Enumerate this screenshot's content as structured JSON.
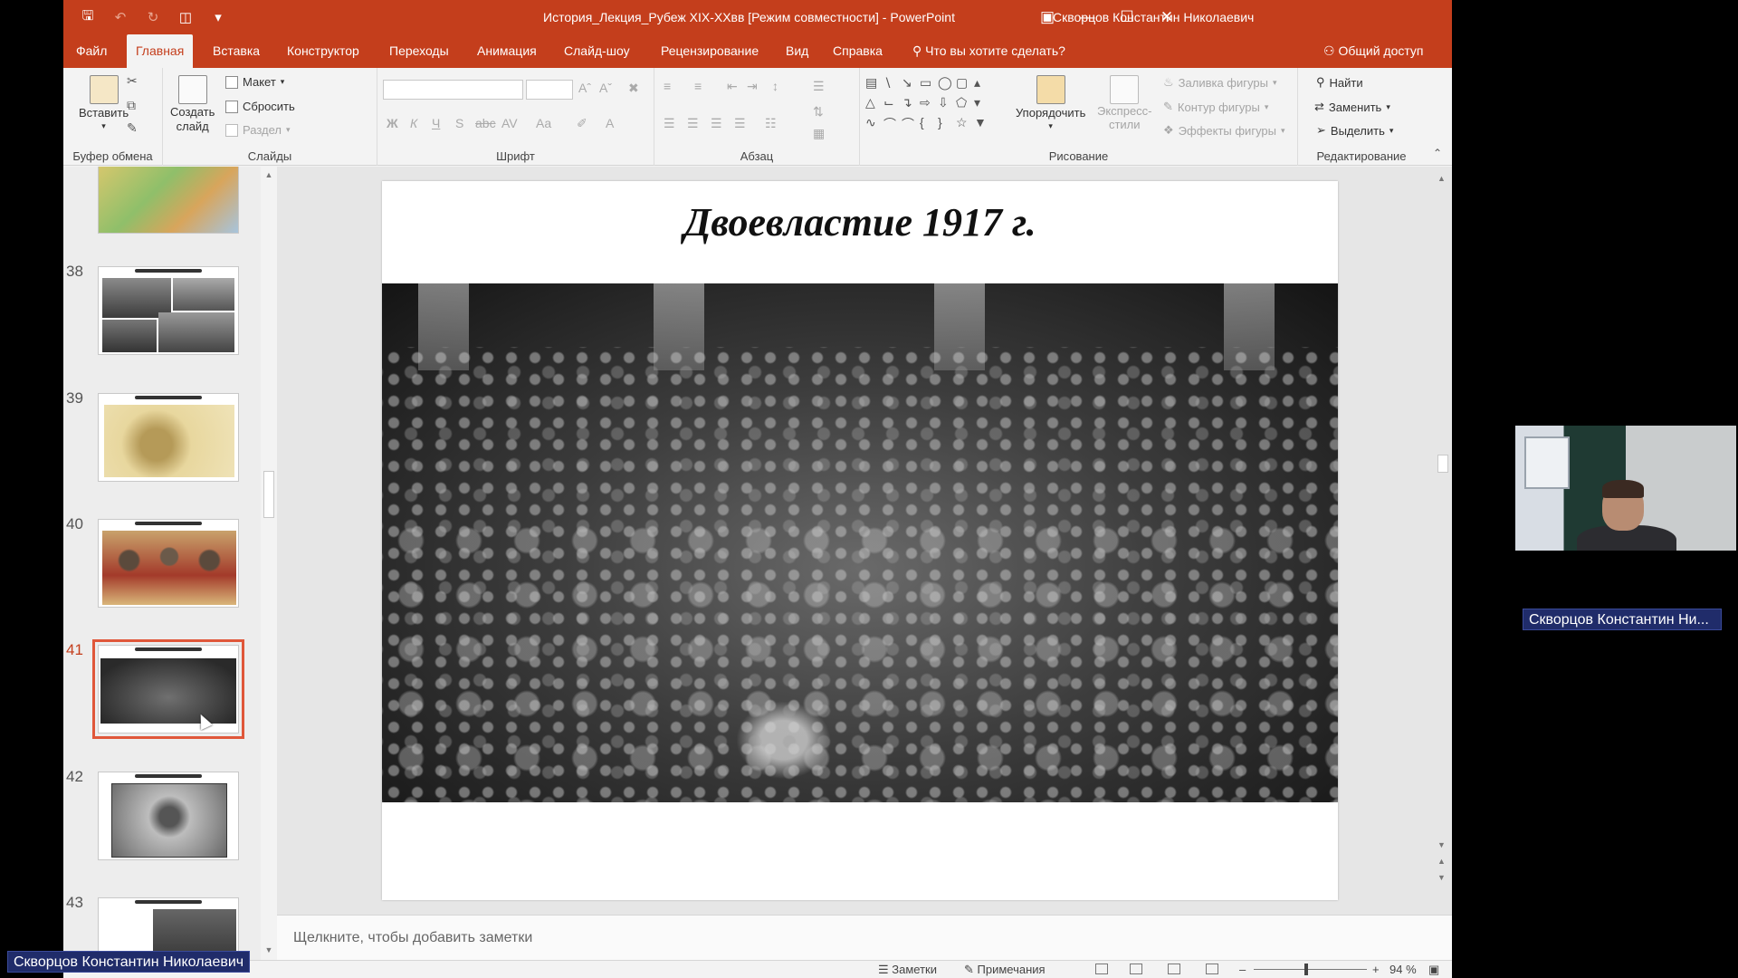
{
  "titlebar": {
    "document_title": "История_Лекция_Рубеж XIX-XXвв [Режим совместности]  -  PowerPoint",
    "user": "Скворцов Константин Николаевич"
  },
  "tabs": [
    "Файл",
    "Главная",
    "Вставка",
    "Конструктор",
    "Переходы",
    "Анимация",
    "Слайд-шоу",
    "Рецензирование",
    "Вид",
    "Справка"
  ],
  "active_tab": "Главная",
  "tell_me": "Что вы хотите сделать?",
  "share": "Общий доступ",
  "ribbon": {
    "clipboard": {
      "paste": "Вставить",
      "label": "Буфер обмена"
    },
    "slides": {
      "new_slide_line1": "Создать",
      "new_slide_line2": "слайд",
      "layout": "Макет",
      "reset": "Сбросить",
      "section": "Раздел",
      "label": "Слайды"
    },
    "font": {
      "label": "Шрифт"
    },
    "paragraph": {
      "label": "Абзац"
    },
    "drawing": {
      "arrange": "Упорядочить",
      "quick_styles_line1": "Экспресс-",
      "quick_styles_line2": "стили",
      "shape_fill": "Заливка фигуры",
      "shape_outline": "Контур фигуры",
      "shape_effects": "Эффекты фигуры",
      "label": "Рисование"
    },
    "editing": {
      "find": "Найти",
      "replace": "Заменить",
      "select": "Выделить",
      "label": "Редактирование"
    }
  },
  "thumbnails": [
    {
      "num": "",
      "kind": "map"
    },
    {
      "num": "38",
      "kind": "collage"
    },
    {
      "num": "39",
      "kind": "cartoon"
    },
    {
      "num": "40",
      "kind": "poster"
    },
    {
      "num": "41",
      "kind": "crowd",
      "selected": true
    },
    {
      "num": "42",
      "kind": "speaker"
    },
    {
      "num": "43",
      "kind": "partial"
    }
  ],
  "slide": {
    "title": "Двоевластие 1917 г."
  },
  "notes_placeholder": "Щелкните, чтобы добавить заметки",
  "statusbar": {
    "notes": "Заметки",
    "comments": "Примечания",
    "zoom": "94 %"
  },
  "webcam_label": "Скворцов Константин Ни...",
  "bottom_label": "Скворцов Константин Николаевич",
  "colors": {
    "accent": "#c43e1c",
    "selected_outline": "#e0573a",
    "label_bg": "#202c6a"
  }
}
